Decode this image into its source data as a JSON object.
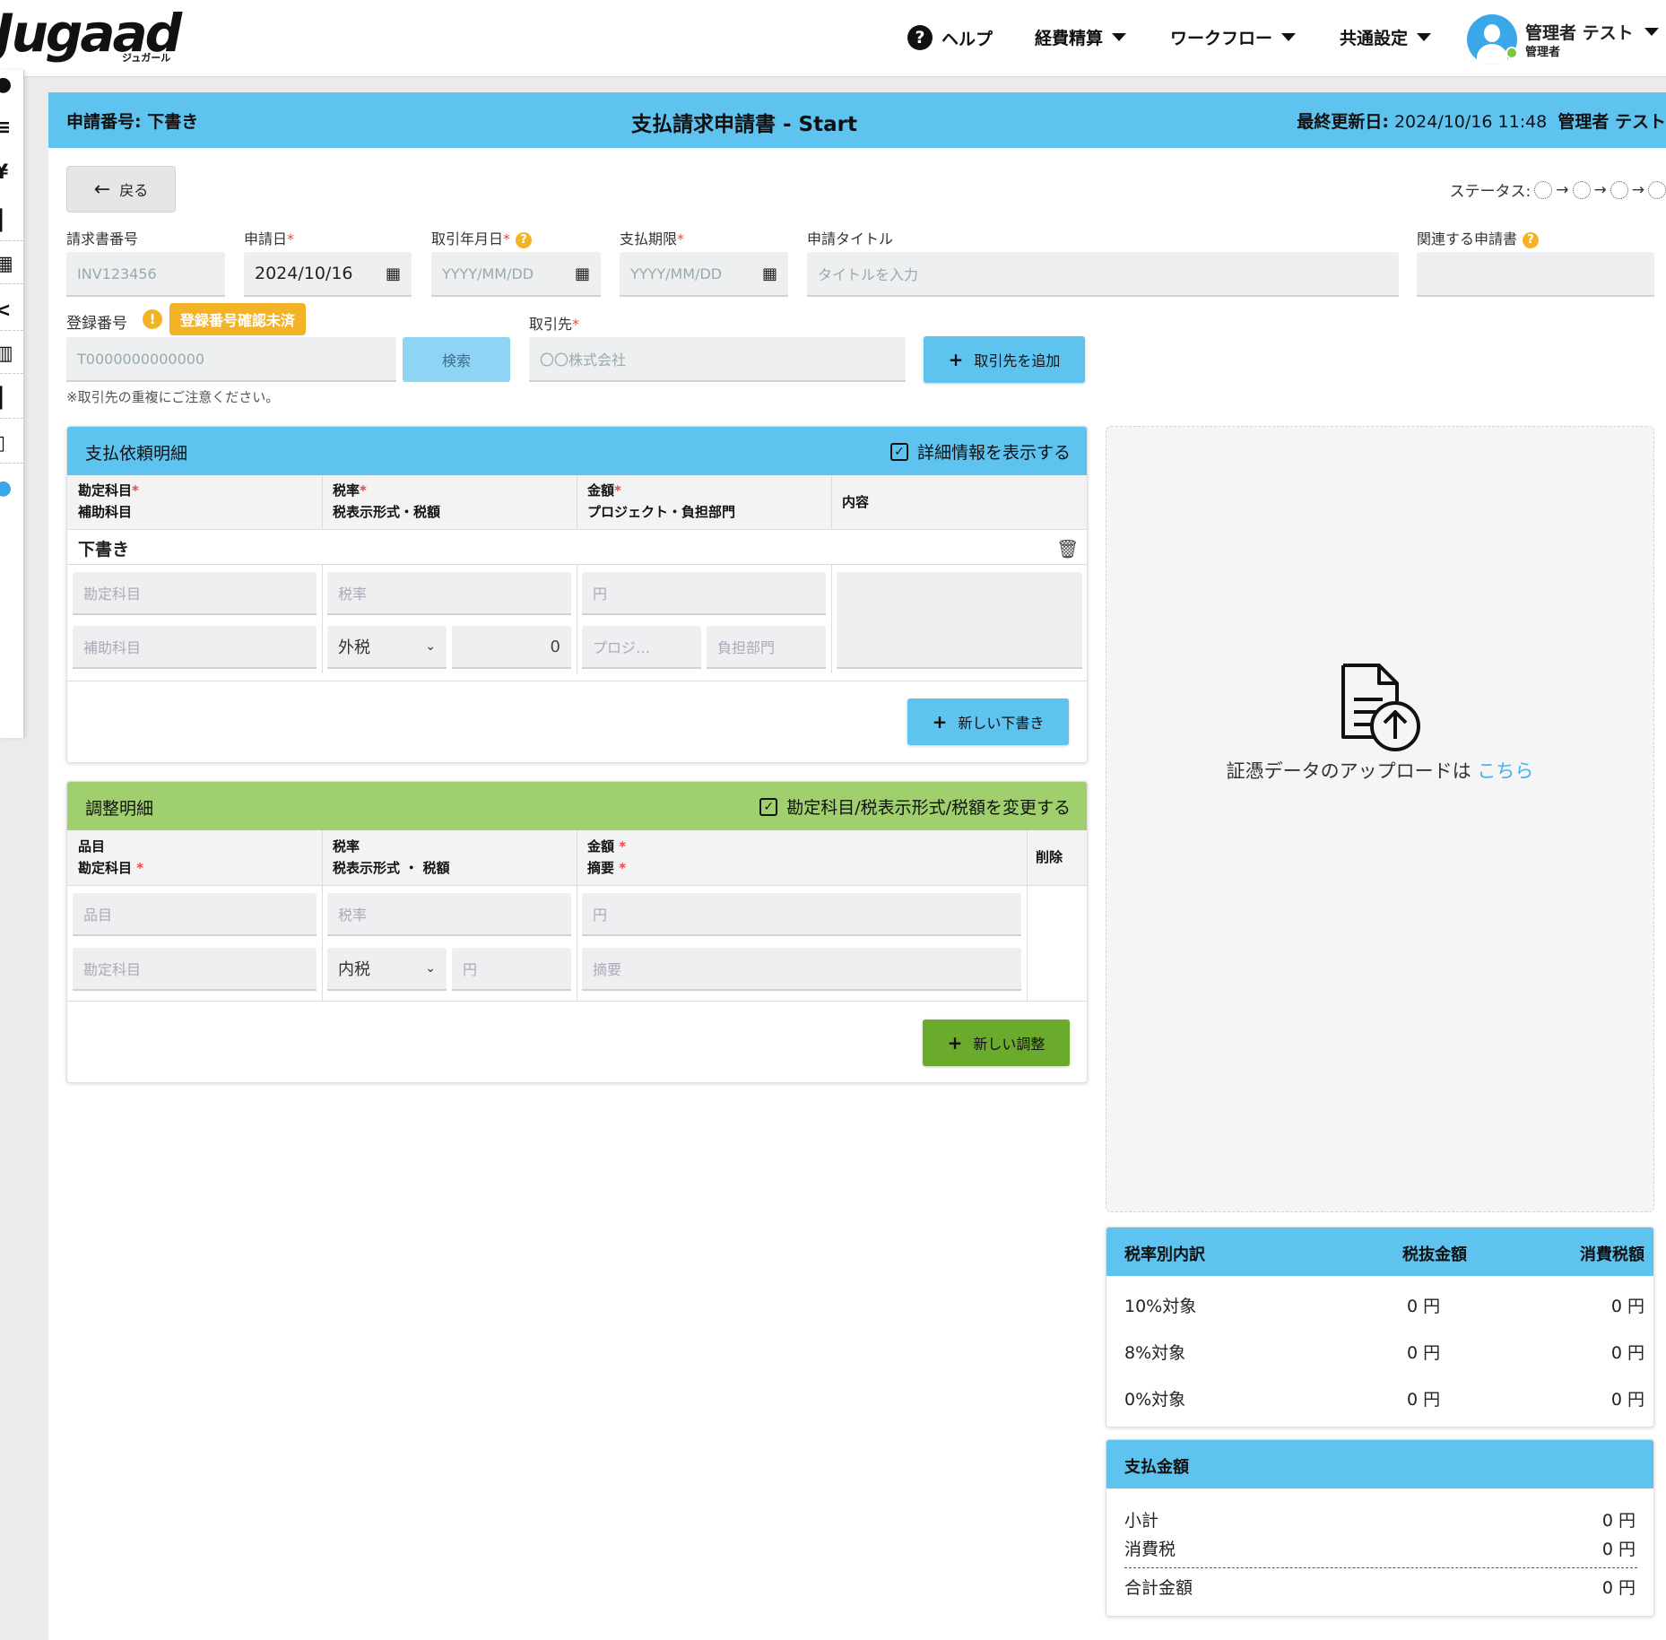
{
  "app": {
    "logo": "Jugaad",
    "logo_sub": "ジュガール"
  },
  "nav": {
    "help": "ヘルプ",
    "expense": "経費精算",
    "workflow": "ワークフロー",
    "settings": "共通設定",
    "user_name": "管理者 テスト",
    "user_role": "管理者"
  },
  "header": {
    "app_no_label": "申請番号:",
    "app_no_value": "下書き",
    "title": "支払請求申請書 - Start",
    "updated_label": "最終更新日:",
    "updated_value": "2024/10/16 11:48",
    "updated_by": "管理者 テスト"
  },
  "back_label": "戻る",
  "status_label": "ステータス:",
  "form": {
    "invoice_no_label": "請求書番号",
    "invoice_no_placeholder": "INV123456",
    "apply_date_label": "申請日",
    "apply_date_value": "2024/10/16",
    "trade_date_label": "取引年月日",
    "trade_date_placeholder": "YYYY/MM/DD",
    "due_label": "支払期限",
    "due_placeholder": "YYYY/MM/DD",
    "title_label": "申請タイトル",
    "title_placeholder": "タイトルを入力",
    "related_label": "関連する申請書",
    "reg_no_label": "登録番号",
    "reg_no_badge": "登録番号確認未済",
    "reg_no_placeholder": "T0000000000000",
    "search_label": "検索",
    "vendor_label": "取引先",
    "vendor_placeholder": "〇〇株式会社",
    "add_vendor_label": "取引先を追加",
    "note": "※取引先の重複にご注意ください。"
  },
  "payment_detail": {
    "title": "支払依頼明細",
    "toggle_label": "詳細情報を表示する",
    "col1_line1": "勘定科目",
    "col1_line2": "補助科目",
    "col2_line1": "税率",
    "col2_line2": "税表示形式・税額",
    "col3_line1": "金額",
    "col3_line2": "プロジェクト・負担部門",
    "col4": "内容",
    "row_title": "下書き",
    "account_ph": "勘定科目",
    "sub_account_ph": "補助科目",
    "tax_rate_ph": "税率",
    "tax_mode": "外税",
    "tax_amount": "0",
    "amount_ph": "円",
    "project_ph": "プロジ…",
    "dept_ph": "負担部門",
    "add_label": "新しい下書き"
  },
  "adjust_detail": {
    "title": "調整明細",
    "toggle_label": "勘定科目/税表示形式/税額を変更する",
    "col1_line1": "品目",
    "col1_line2": "勘定科目",
    "col2_line1": "税率",
    "col2_line2": "税表示形式 ・ 税額",
    "col3_line1": "金額",
    "col3_line2": "摘要",
    "col4": "削除",
    "item_ph": "品目",
    "account_ph": "勘定科目",
    "tax_rate_ph": "税率",
    "tax_mode": "内税",
    "tax_amount_ph": "円",
    "amount_ph": "円",
    "memo_ph": "摘要",
    "add_label": "新しい調整"
  },
  "upload": {
    "text": "証憑データのアップロードは",
    "link": "こちら"
  },
  "tax_breakdown": {
    "h1": "税率別内訳",
    "h2": "税抜金額",
    "h3": "消費税額",
    "rows": [
      {
        "label": "10%対象",
        "net": "0 円",
        "tax": "0 円"
      },
      {
        "label": "8%対象",
        "net": "0 円",
        "tax": "0 円"
      },
      {
        "label": "0%対象",
        "net": "0 円",
        "tax": "0 円"
      }
    ]
  },
  "payment_total": {
    "title": "支払金額",
    "subtotal_label": "小計",
    "subtotal": "0 円",
    "tax_label": "消費税",
    "tax": "0 円",
    "total_label": "合計金額",
    "total": "0 円"
  }
}
